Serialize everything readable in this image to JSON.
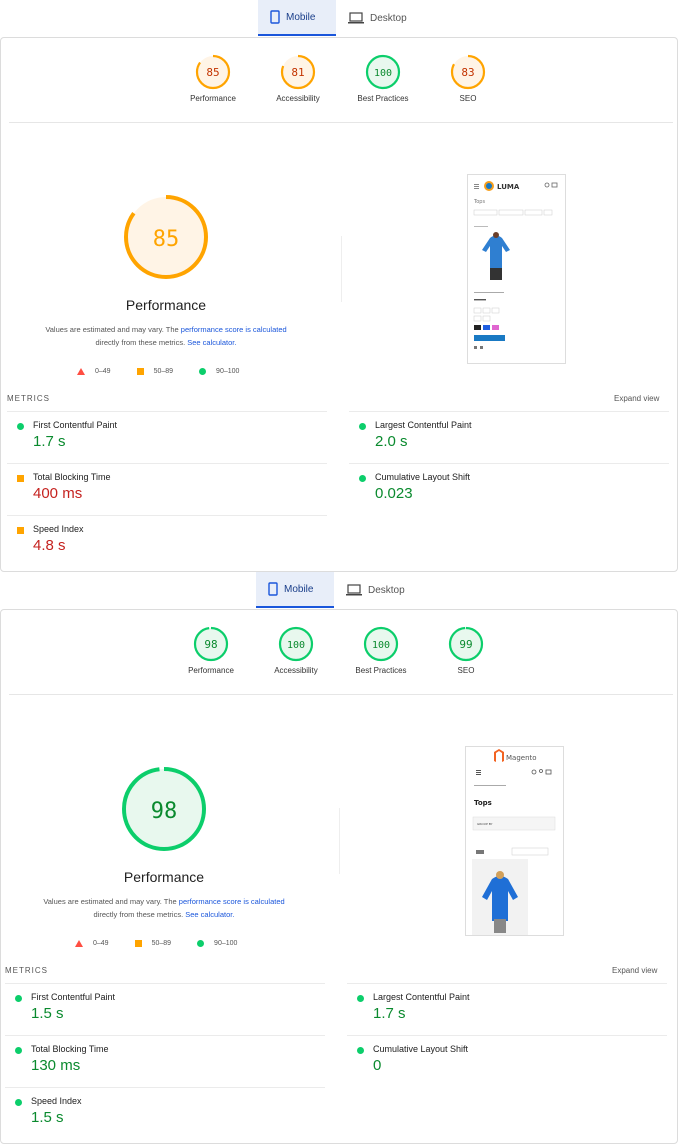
{
  "tabs": {
    "mobile": "Mobile",
    "desktop": "Desktop"
  },
  "colors": {
    "orange": "#ffa400",
    "orange_text": "#c33300",
    "green": "#0cce6b",
    "green_text": "#0a8a2e",
    "red": "#ff4e42",
    "link": "#1a56db"
  },
  "panels": [
    {
      "scores": [
        {
          "label": "Performance",
          "value": "85"
        },
        {
          "label": "Accessibility",
          "value": "81"
        },
        {
          "label": "Best Practices",
          "value": "100"
        },
        {
          "label": "SEO",
          "value": "83"
        }
      ],
      "big_score": "85",
      "perf_title": "Performance",
      "note_pre": "Values are estimated and may vary. The ",
      "note_link1": "performance score is calculated",
      "note_mid": "directly from these metrics. ",
      "note_link2": "See calculator.",
      "legend": [
        "0–49",
        "50–89",
        "90–100"
      ],
      "metrics_label": "METRICS",
      "expand": "Expand view",
      "metrics": [
        {
          "name": "First Contentful Paint",
          "value": "1.7 s"
        },
        {
          "name": "Largest Contentful Paint",
          "value": "2.0 s"
        },
        {
          "name": "Total Blocking Time",
          "value": "400 ms"
        },
        {
          "name": "Cumulative Layout Shift",
          "value": "0.023"
        },
        {
          "name": "Speed Index",
          "value": "4.8 s"
        }
      ],
      "shot": {
        "brand": "LUMA",
        "heading": "Tops"
      }
    },
    {
      "scores": [
        {
          "label": "Performance",
          "value": "98"
        },
        {
          "label": "Accessibility",
          "value": "100"
        },
        {
          "label": "Best Practices",
          "value": "100"
        },
        {
          "label": "SEO",
          "value": "99"
        }
      ],
      "big_score": "98",
      "perf_title": "Performance",
      "note_pre": "Values are estimated and may vary. The ",
      "note_link1": "performance score is calculated",
      "note_mid": "directly from these metrics. ",
      "note_link2": "See calculator.",
      "legend": [
        "0–49",
        "50–89",
        "90–100"
      ],
      "metrics_label": "METRICS",
      "expand": "Expand view",
      "metrics": [
        {
          "name": "First Contentful Paint",
          "value": "1.5 s"
        },
        {
          "name": "Largest Contentful Paint",
          "value": "1.7 s"
        },
        {
          "name": "Total Blocking Time",
          "value": "130 ms"
        },
        {
          "name": "Cumulative Layout Shift",
          "value": "0"
        },
        {
          "name": "Speed Index",
          "value": "1.5 s"
        }
      ],
      "shot": {
        "brand": "Magento",
        "heading": "Tops",
        "group_by": "GROUP BY"
      }
    }
  ]
}
